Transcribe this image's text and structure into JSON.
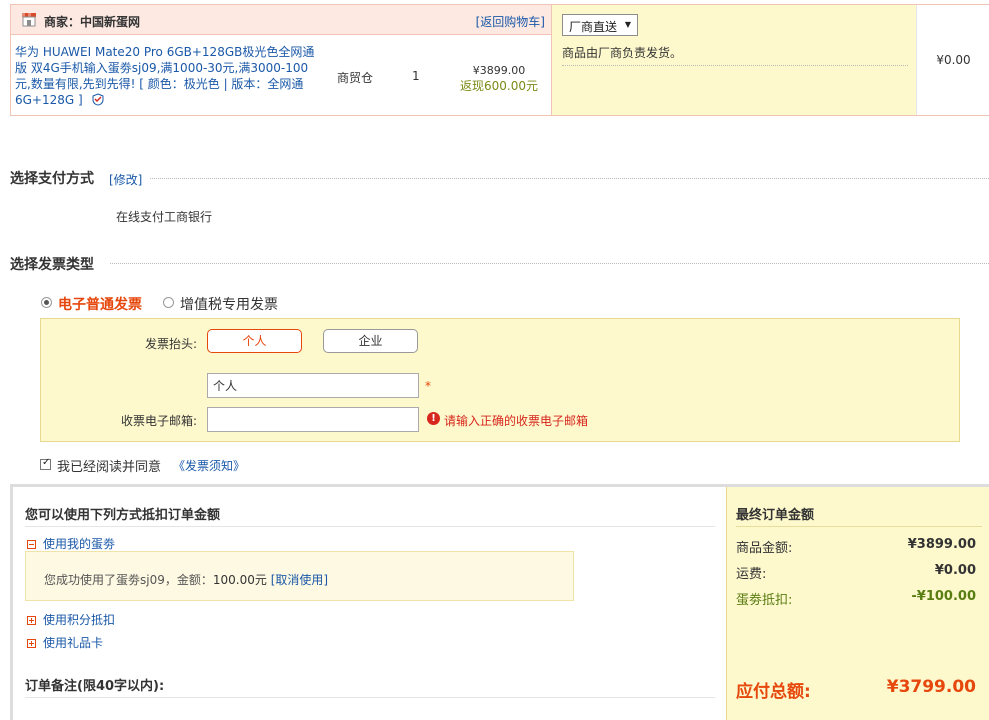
{
  "order": {
    "merchant": "商家：中国新蛋网",
    "back_to_cart": "[返回购物车]",
    "product_name": "华为 HUAWEI Mate20 Pro 6GB+128GB极光色全网通版 双4G手机输入蛋劵sj09,满1000-30元,满3000-100元,数量有限,先到先得! [ 颜色：极光色 | 版本：全网通 6G+128G ]",
    "warehouse": "商贸仓",
    "quantity": "1",
    "price": "¥3899.00",
    "cashback": "返现600.00元",
    "shipping_select": "厂商直送",
    "shipping_note": "商品由厂商负责发货。",
    "shipping_fee": "¥0.00"
  },
  "payment": {
    "title": "选择支付方式",
    "modify": "[修改]",
    "method": "在线支付工商银行"
  },
  "invoice": {
    "title": "选择发票类型",
    "type_electronic": "电子普通发票",
    "type_vat": "增值税专用发票",
    "header_label": "发票抬头:",
    "btn_personal": "个人",
    "btn_company": "企业",
    "header_value": "个人",
    "required_mark": "*",
    "email_label": "收票电子邮箱:",
    "email_value": "",
    "error_icon": "!",
    "error_text": "请输入正确的收票电子邮箱",
    "agree_text": "我已经阅读并同意",
    "notice_link": "《发票须知》"
  },
  "discount": {
    "title": "您可以使用下列方式抵扣订单金额",
    "use_coupon": "使用我的蛋劵",
    "coupon_msg": "您成功使用了蛋劵sj09，金额：",
    "coupon_amount": "100.00元",
    "cancel": "[取消使用]",
    "use_points": "使用积分抵扣",
    "use_giftcard": "使用礼品卡",
    "remark_title": "订单备注(限40字以内):"
  },
  "summary": {
    "title": "最终订单金额",
    "goods_label": "商品金额:",
    "goods_value": "¥3899.00",
    "freight_label": "运费:",
    "freight_value": "¥0.00",
    "coupon_label": "蛋劵抵扣:",
    "coupon_value": "-¥100.00",
    "total_label": "应付总额:",
    "total_value": "¥3799.00"
  },
  "colors": {
    "link": "#1a58a8",
    "accent": "#e6470c",
    "panel": "#fdf9cd",
    "discount_green": "#5a7d12"
  }
}
